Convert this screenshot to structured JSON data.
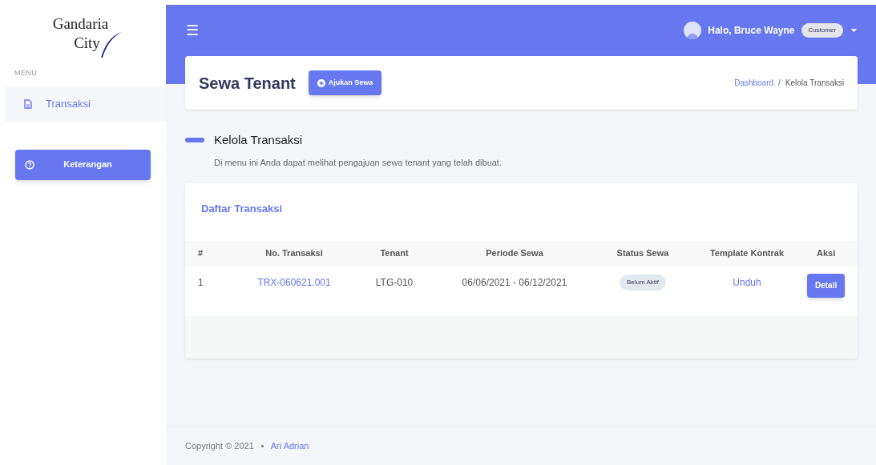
{
  "logo": {
    "line1": "Gandaria",
    "line2": "City"
  },
  "sidebar": {
    "heading": "MENU",
    "items": [
      {
        "label": "Transaksi",
        "selected": true
      }
    ],
    "help_button": "Keterangan"
  },
  "navbar": {
    "menu_icon": "☰",
    "greeting": "Halo, Bruce Wayne",
    "role_badge": "Customer"
  },
  "page_header": {
    "title": "Sewa Tenant",
    "action_button": "Ajukan Sewa",
    "breadcrumb_separator": "/",
    "breadcrumb": [
      {
        "label": "Dashboard",
        "selected": false
      },
      {
        "label": "Kelola Transaksi",
        "selected": true
      }
    ]
  },
  "section": {
    "title": "Kelola Transaksi",
    "description": "Di menu ini Anda dapat melihat pengajuan sewa tenant yang telah dibuat."
  },
  "table": {
    "title": "Daftar Transaksi",
    "columns": [
      "#",
      "No. Transaksi",
      "Tenant",
      "Periode Sewa",
      "Status Sewa",
      "Template Kontrak",
      "Aksi"
    ],
    "rows": [
      {
        "number": "1",
        "transaction_no": "TRX-060621.001",
        "tenant": "LTG-010",
        "period": "06/06/2021 - 06/12/2021",
        "status": "Belum Aktif",
        "template": "Unduh",
        "action": "Detail"
      }
    ]
  },
  "footer": {
    "copyright": "Copyright © 2021",
    "author": "Ari Adrian"
  }
}
